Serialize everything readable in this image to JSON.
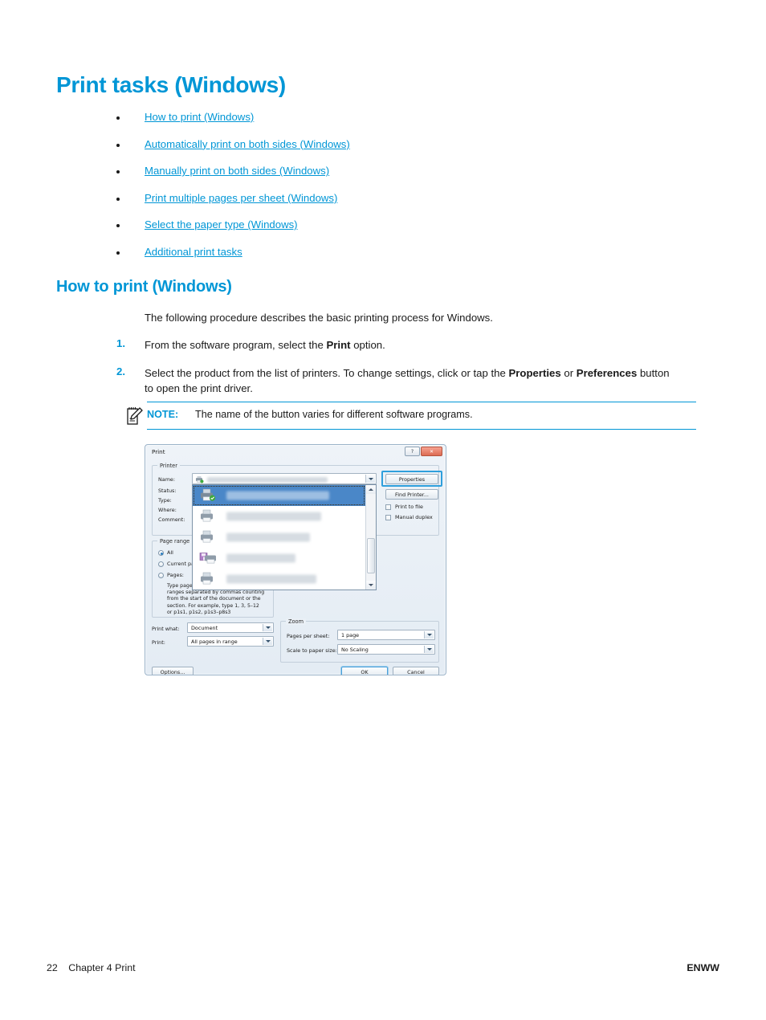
{
  "colors": {
    "hp_blue": "#0096d6",
    "text": "#1a1a1a",
    "dialog_selection": "#4a87c8",
    "highlight_border": "#2f9fdc"
  },
  "page_title": "Print tasks (Windows)",
  "toc_links": [
    {
      "label": "How to print (Windows)"
    },
    {
      "label": "Automatically print on both sides (Windows)"
    },
    {
      "label": "Manually print on both sides (Windows)"
    },
    {
      "label": "Print multiple pages per sheet (Windows)"
    },
    {
      "label": "Select the paper type (Windows)"
    },
    {
      "label": "Additional print tasks"
    }
  ],
  "section": {
    "heading": "How to print (Windows)",
    "intro": "The following procedure describes the basic printing process for Windows.",
    "steps": [
      {
        "number": "1.",
        "text_parts": [
          {
            "text": "From the software program, select the ",
            "bold": false
          },
          {
            "text": "Print",
            "bold": true
          },
          {
            "text": " option.",
            "bold": false
          }
        ]
      },
      {
        "number": "2.",
        "text_parts": [
          {
            "text": "Select the product from the list of printers. To change settings, click or tap the ",
            "bold": false
          },
          {
            "text": "Properties",
            "bold": true
          },
          {
            "text": " or ",
            "bold": false
          },
          {
            "text": "Preferences",
            "bold": true
          },
          {
            "text": " button to open the print driver.",
            "bold": false
          }
        ]
      }
    ]
  },
  "note": {
    "icon": "note-pencil-icon",
    "label": "NOTE:",
    "text": "The name of the button varies for different software programs."
  },
  "print_dialog": {
    "title": "Print",
    "titlebar_buttons": [
      {
        "name": "help-button",
        "glyph": "?"
      },
      {
        "name": "close-button",
        "glyph": "✕"
      }
    ],
    "printer_group": {
      "title": "Printer",
      "labels": {
        "name": "Name:",
        "status": "Status:",
        "type": "Type:",
        "where": "Where:",
        "comment": "Comment:"
      },
      "buttons": {
        "properties": "Properties",
        "find_printer": "Find Printer..."
      },
      "checkboxes": [
        {
          "label": "Print to file",
          "checked": false
        },
        {
          "label": "Manual duplex",
          "checked": false
        }
      ]
    },
    "dropdown": {
      "open": true,
      "item_count": 6,
      "selected_index": 0
    },
    "page_range": {
      "title": "Page range",
      "options": [
        {
          "label": "All",
          "selected": true
        },
        {
          "label": "Current page",
          "selected": false
        },
        {
          "label": "Pages:",
          "selected": false
        }
      ],
      "hint_lines": [
        "Type page numbers and/or page",
        "ranges separated by commas counting",
        "from the start of the document or the",
        "section. For example, type 1, 3, 5–12",
        "or p1s1, p1s2, p1s3–p8s3"
      ]
    },
    "print_what": {
      "label": "Print what:",
      "value": "Document"
    },
    "print_filter": {
      "label": "Print:",
      "value": "All pages in range"
    },
    "zoom_group": {
      "title": "Zoom",
      "pages_per_sheet": {
        "label": "Pages per sheet:",
        "value": "1 page"
      },
      "scale_to_paper": {
        "label": "Scale to paper size:",
        "value": "No Scaling"
      }
    },
    "footer_buttons": {
      "options": "Options...",
      "ok": "OK",
      "cancel": "Cancel"
    }
  },
  "footer": {
    "page_number": "22",
    "chapter": "Chapter 4  Print",
    "right": "ENWW"
  }
}
